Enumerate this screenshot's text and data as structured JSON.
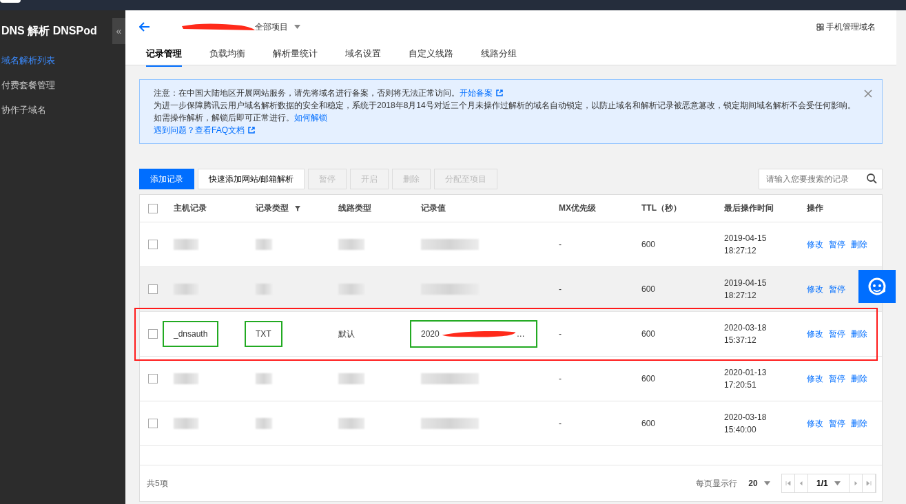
{
  "sidebar": {
    "title": "DNS 解析 DNSPod",
    "collapse": "«",
    "items": [
      {
        "label": "域名解析列表",
        "selected": true
      },
      {
        "label": "付费套餐管理",
        "selected": false
      },
      {
        "label": "协作子域名",
        "selected": false
      }
    ]
  },
  "header": {
    "project_redacted": true,
    "project": "全部项目",
    "mobile_link": "手机管理域名"
  },
  "tabs": [
    {
      "label": "记录管理",
      "selected": true
    },
    {
      "label": "负载均衡",
      "selected": false
    },
    {
      "label": "解析量统计",
      "selected": false
    },
    {
      "label": "域名设置",
      "selected": false
    },
    {
      "label": "自定义线路",
      "selected": false
    },
    {
      "label": "线路分组",
      "selected": false
    }
  ],
  "notice": {
    "lines": [
      {
        "text": "注意：在中国大陆地区开展网站服务，请先将域名进行备案，否则将无法正常访问。",
        "link": "开始备案",
        "external": true
      },
      {
        "text": "为进一步保障腾讯云用户域名解析数据的安全和稳定，系统于2018年8月14号对近三个月未操作过解析的域名自动锁定，以防止域名和解析记录被恶意篡改，锁定期间域名解析不会受任何影响。"
      },
      {
        "text": "如需操作解析，解锁后即可正常进行。",
        "link": "如何解锁",
        "external": false
      },
      {
        "link": "遇到问题？查看FAQ文档",
        "external": true
      }
    ]
  },
  "toolbar": {
    "buttons": [
      {
        "label": "添加记录",
        "kind": "primary",
        "disabled": false
      },
      {
        "label": "快速添加网站/邮箱解析",
        "kind": "default",
        "disabled": false
      },
      {
        "label": "暂停",
        "kind": "default",
        "disabled": true
      },
      {
        "label": "开启",
        "kind": "default",
        "disabled": true
      },
      {
        "label": "删除",
        "kind": "default",
        "disabled": true
      },
      {
        "label": "分配至项目",
        "kind": "default",
        "disabled": true
      }
    ],
    "search_placeholder": "请输入您要搜索的记录"
  },
  "table": {
    "all_checked": false,
    "columns": [
      "主机记录",
      "记录类型",
      "线路类型",
      "记录值",
      "MX优先级",
      "TTL（秒）",
      "最后操作时间",
      "操作"
    ],
    "rows": [
      {
        "checked": false,
        "hover": false,
        "highlighted": false,
        "host": {
          "blurred": true
        },
        "type": {
          "blurred": true
        },
        "line": {
          "blurred": true
        },
        "value": {
          "blurred": true
        },
        "mx": "-",
        "ttl": "600",
        "date": "2019-04-15",
        "time": "18:27:12",
        "actions": [
          "修改",
          "暂停",
          "删除"
        ]
      },
      {
        "checked": false,
        "hover": true,
        "highlighted": false,
        "host": {
          "blurred": true
        },
        "type": {
          "blurred": true
        },
        "line": {
          "blurred": true
        },
        "value": {
          "blurred": true
        },
        "mx": "-",
        "ttl": "600",
        "date": "2019-04-15",
        "time": "18:27:12",
        "actions": [
          "修改",
          "暂停"
        ]
      },
      {
        "checked": false,
        "hover": false,
        "highlighted": true,
        "host": {
          "text": "_dnsauth",
          "outlined": true
        },
        "type": {
          "text": "TXT",
          "outlined": true
        },
        "line": {
          "text": "默认"
        },
        "value": {
          "text": "2020",
          "redacted": true,
          "suffix": "…",
          "outlined": true
        },
        "mx": "-",
        "ttl": "600",
        "date": "2020-03-18",
        "time": "15:37:12",
        "actions": [
          "修改",
          "暂停",
          "删除"
        ]
      },
      {
        "checked": false,
        "hover": false,
        "highlighted": false,
        "host": {
          "blurred": true
        },
        "type": {
          "blurred": true
        },
        "line": {
          "blurred": true
        },
        "value": {
          "blurred": true
        },
        "mx": "-",
        "ttl": "600",
        "date": "2020-01-13",
        "time": "17:20:51",
        "actions": [
          "修改",
          "暂停",
          "删除"
        ]
      },
      {
        "checked": false,
        "hover": false,
        "highlighted": false,
        "host": {
          "blurred": true
        },
        "type": {
          "blurred": true
        },
        "line": {
          "blurred": true
        },
        "value": {
          "blurred": true
        },
        "mx": "-",
        "ttl": "600",
        "date": "2020-03-18",
        "time": "15:40:00",
        "actions": [
          "修改",
          "暂停",
          "删除"
        ]
      }
    ]
  },
  "footer": {
    "total": "共5项",
    "per_page_label": "每页显示行",
    "per_page": "20",
    "page": "1/1"
  }
}
